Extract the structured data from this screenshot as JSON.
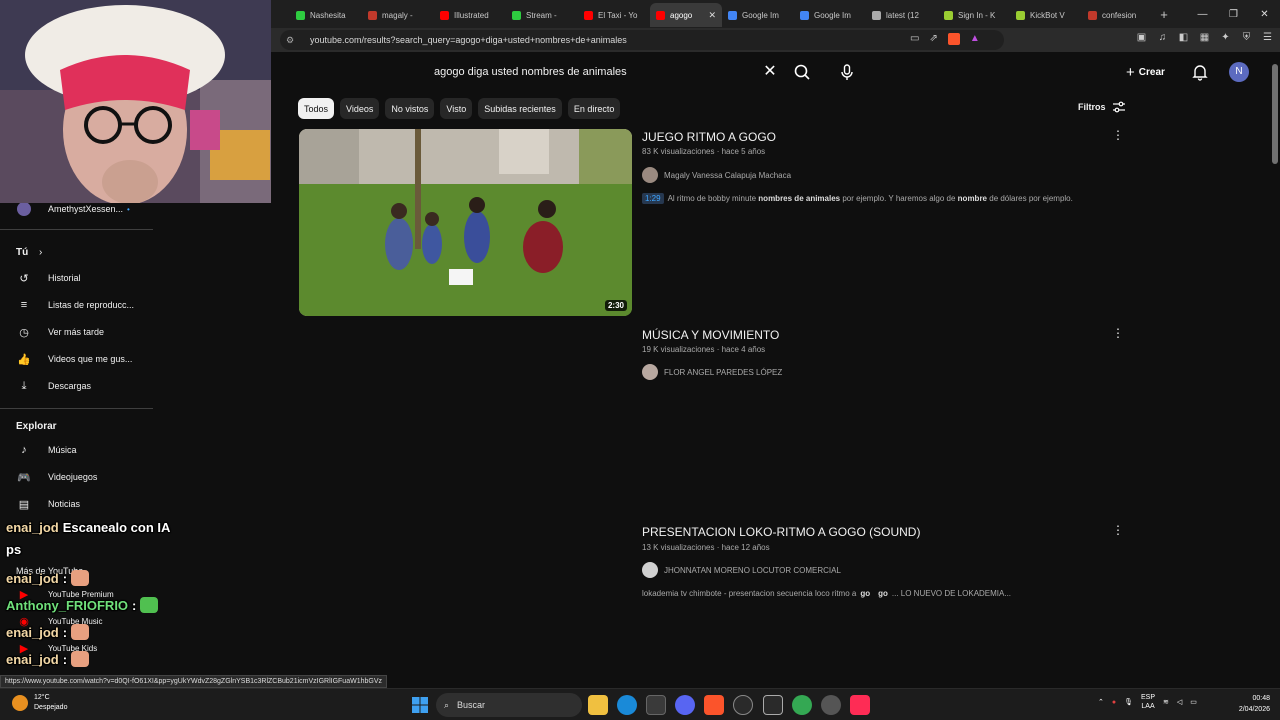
{
  "browser": {
    "tabs": [
      {
        "label": "Nashesita",
        "color": "#2ecc40"
      },
      {
        "label": "magaly -",
        "color": "#c0392b"
      },
      {
        "label": "Illustrated",
        "color": "#ff0000"
      },
      {
        "label": "Stream -",
        "color": "#2ecc40"
      },
      {
        "label": "El Taxi - Yo",
        "color": "#ff0000"
      },
      {
        "label": "agogo",
        "color": "#ff0000"
      },
      {
        "label": "Google Im",
        "color": "#4285f4"
      },
      {
        "label": "Google Im",
        "color": "#4285f4"
      },
      {
        "label": "latest (12",
        "color": "#aaaaaa"
      },
      {
        "label": "Sign In - K",
        "color": "#9acd32"
      },
      {
        "label": "KickBot V",
        "color": "#9acd32"
      },
      {
        "label": "confesion",
        "color": "#c0392b"
      }
    ],
    "url": "youtube.com/results?search_query=agogo+diga+usted+nombres+de+animales"
  },
  "youtube": {
    "search_value": "agogo diga usted nombres de animales",
    "create_label": "Crear",
    "avatar_letter": "N",
    "chips": [
      "Todos",
      "Videos",
      "No vistos",
      "Visto",
      "Subidas recientes",
      "En directo"
    ],
    "filters_label": "Filtros"
  },
  "sidebar": {
    "subscription": "AmethystXessen...",
    "you_header": "Tú",
    "you_items": [
      "Historial",
      "Listas de reproducc...",
      "Ver más tarde",
      "Videos que me gus...",
      "Descargas"
    ],
    "explore_header": "Explorar",
    "explore_items": [
      "Música",
      "Videojuegos",
      "Noticias"
    ],
    "more_header": "Más de YouTube",
    "more_items": [
      "YouTube Premium",
      "YouTube Music",
      "YouTube Kids"
    ]
  },
  "results": [
    {
      "title": "JUEGO RITMO A GOGO",
      "views": "83 K visualizaciones",
      "age": "hace 5 años",
      "channel": "Magaly Vanessa Calapuja Machaca",
      "chapter_time": "1:29",
      "desc_parts": [
        "Al ritmo de bobby minute ",
        "nombres de animales",
        " por ejemplo. Y haremos algo de ",
        "nombre",
        " de dólares por ejemplo."
      ],
      "duration": "2:30"
    },
    {
      "title": "MÚSICA Y MOVIMIENTO",
      "views": "19 K visualizaciones",
      "age": "hace 4 años",
      "channel": "FLOR ANGEL PAREDES LÓPEZ"
    },
    {
      "title": "PRESENTACION LOKO-RITMO A GOGO (SOUND)",
      "views": "13 K visualizaciones",
      "age": "hace 12 años",
      "channel": "JHONNATAN MORENO LOCUTOR COMERCIAL",
      "desc_parts": [
        "lokademia tv chimbote - presentacion secuencia loco ritmo a ",
        "go",
        " ",
        "go",
        "... LO NUEVO DE LOKADEMIA..."
      ]
    }
  ],
  "chat": [
    {
      "user": "enai_jod",
      "color": "#f3d8a6",
      "msg": "Escanealo con IA"
    },
    {
      "user": "",
      "color": "#ffffff",
      "msg": "ps"
    },
    {
      "user": "enai_jod",
      "color": "#f3d8a6",
      "msg": ":"
    },
    {
      "user": "Anthony_FRIOFRIO",
      "color": "#6fe07a",
      "msg": ":"
    },
    {
      "user": "enai_jod",
      "color": "#f3d8a6",
      "msg": ":"
    },
    {
      "user": "enai_jod",
      "color": "#f3d8a6",
      "msg": ":"
    }
  ],
  "status_url": "https://www.youtube.com/watch?v=d0QI-fO61XI&pp=ygUkYWdvZ28gZGlnYSB1c3RlZCBub21icmVzIGRlIGFuaW1hbGVz",
  "taskbar": {
    "temp": "12°C",
    "weather": "Despejado",
    "search_label": "Buscar",
    "lang1": "ESP",
    "lang2": "LAA",
    "time": "00:48",
    "date": "2/04/2026"
  }
}
